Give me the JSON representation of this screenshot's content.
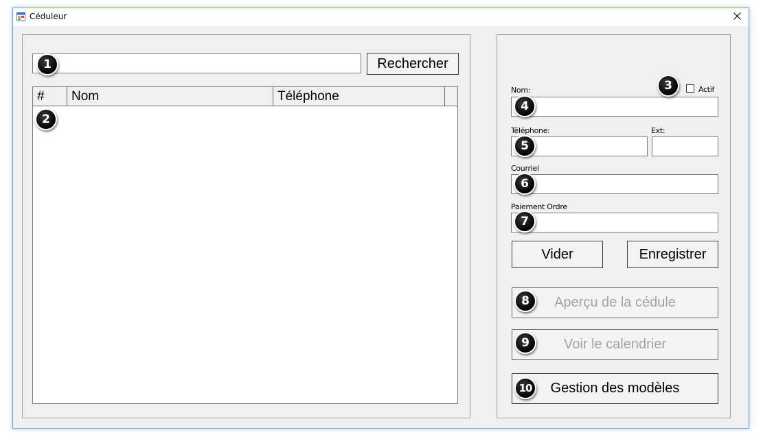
{
  "window": {
    "title": "Céduleur",
    "close_glyph": "✕",
    "icon": "app-window-icon"
  },
  "search": {
    "value": "",
    "placeholder": "",
    "button_label": "Rechercher"
  },
  "grid": {
    "columns": [
      "#",
      "Nom",
      "Téléphone"
    ],
    "rows": []
  },
  "form": {
    "actif_label": "Actif",
    "actif_checked": false,
    "nom_label": "Nom:",
    "nom_value": "",
    "telephone_label": "Téléphone:",
    "telephone_value": "",
    "ext_label": "Ext:",
    "ext_value": "",
    "courriel_label": "Courriel",
    "courriel_value": "",
    "paiement_label": "Paiement Ordre",
    "paiement_value": ""
  },
  "buttons": {
    "vider": "Vider",
    "enregistrer": "Enregistrer",
    "apercu": "Aperçu de la cédule",
    "calendrier": "Voir le calendrier",
    "gestion": "Gestion des modèles"
  },
  "callouts": [
    "1",
    "2",
    "3",
    "4",
    "5",
    "6",
    "7",
    "8",
    "9",
    "10"
  ],
  "colors": {
    "window_border": "#6ea2d6",
    "background": "#f0f0f0",
    "disabled_text": "#a3a3a3"
  }
}
